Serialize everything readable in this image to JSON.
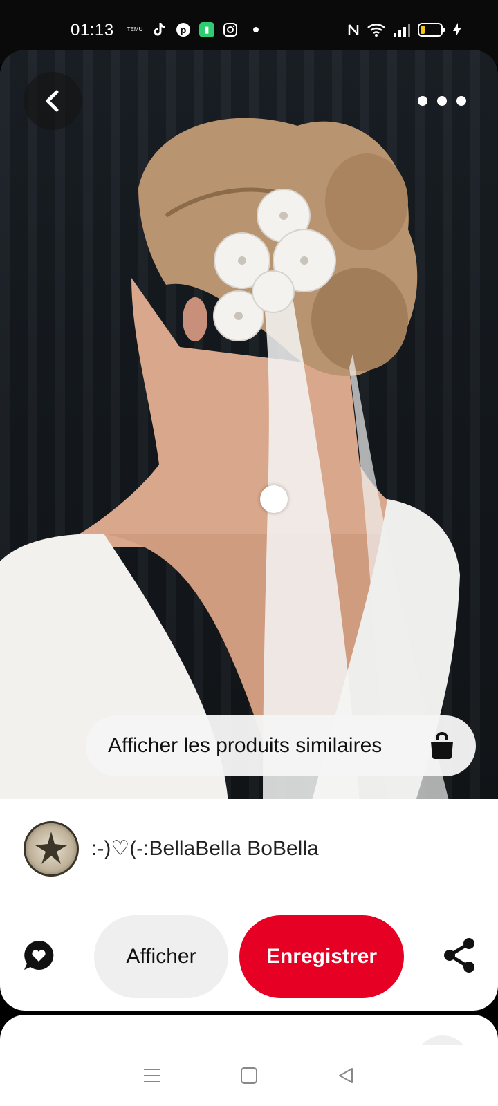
{
  "status_bar": {
    "time": "01:13",
    "app_icons": [
      "temu-icon",
      "tiktok-icon",
      "pinterest-icon",
      "green-app-icon",
      "instagram-icon",
      "notification-dot"
    ],
    "temu_label": "TEMU",
    "system_icons": [
      "nfc-icon",
      "wifi-icon",
      "signal-icon",
      "battery-icon",
      "charging-icon"
    ]
  },
  "hero": {
    "back_icon": "chevron-left-icon",
    "more_icon": "more-horizontal-icon",
    "similar_products_label": "Afficher les produits similaires",
    "similar_products_icon": "shopping-bag-icon"
  },
  "pin": {
    "author": ":-)♡(-:BellaBella BoBella"
  },
  "actions": {
    "comment_icon": "comment-heart-icon",
    "view_label": "Afficher",
    "save_label": "Enregistrer",
    "share_icon": "share-icon"
  },
  "colors": {
    "save_red": "#e60023",
    "view_gray": "#efefef"
  },
  "navigation": {
    "buttons": [
      "menu-icon",
      "home-square-icon",
      "back-triangle-icon"
    ]
  }
}
